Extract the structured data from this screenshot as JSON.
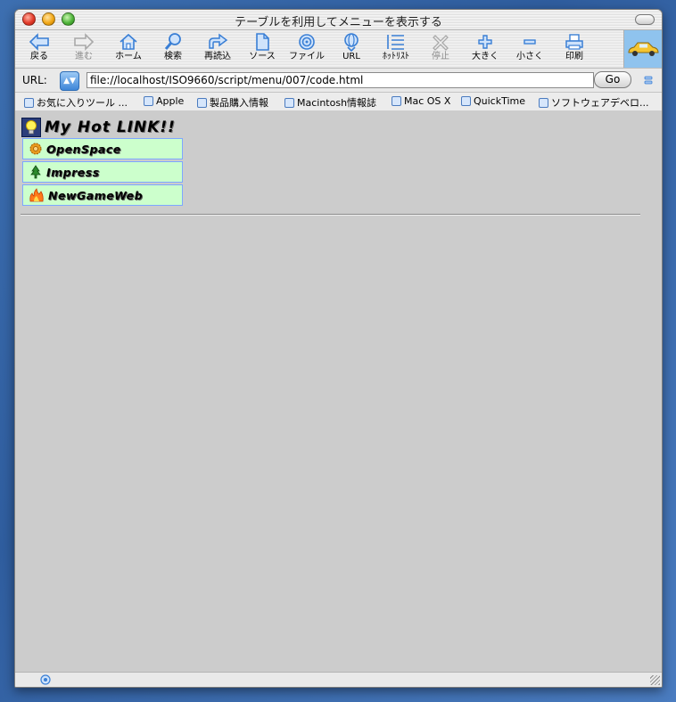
{
  "window": {
    "title": "テーブルを利用してメニューを表示する"
  },
  "toolbar": {
    "buttons": [
      {
        "label": "戻る",
        "icon": "back-arrow-icon",
        "enabled": true
      },
      {
        "label": "進む",
        "icon": "forward-arrow-icon",
        "enabled": false
      },
      {
        "label": "ホーム",
        "icon": "home-icon",
        "enabled": true
      },
      {
        "label": "検索",
        "icon": "search-icon",
        "enabled": true
      },
      {
        "label": "再読込",
        "icon": "reload-icon",
        "enabled": true
      },
      {
        "label": "ソース",
        "icon": "source-document-icon",
        "enabled": true
      },
      {
        "label": "ファイル",
        "icon": "file-target-icon",
        "enabled": true
      },
      {
        "label": "URL",
        "icon": "url-globe-icon",
        "enabled": true
      },
      {
        "label": "ﾎｯﾄﾘｽﾄ",
        "icon": "hotlist-icon",
        "enabled": true
      },
      {
        "label": "停止",
        "icon": "stop-icon",
        "enabled": false
      },
      {
        "label": "大きく",
        "icon": "plus-icon",
        "enabled": true
      },
      {
        "label": "小さく",
        "icon": "minus-icon",
        "enabled": true
      },
      {
        "label": "印刷",
        "icon": "printer-icon",
        "enabled": true
      }
    ]
  },
  "urlbar": {
    "label": "URL:",
    "value": "file://localhost/ISO9660/script/menu/007/code.html",
    "go_label": "Go"
  },
  "favorites": [
    {
      "label": "お気に入りツール ..."
    },
    {
      "label": "Apple"
    },
    {
      "label": "製品購入情報"
    },
    {
      "label": "Macintosh情報誌"
    },
    {
      "label": "Mac OS X"
    },
    {
      "label": "QuickTime"
    },
    {
      "label": "ソフトウェアデベロ..."
    }
  ],
  "page": {
    "heading": "My Hot LINK!!",
    "menu": [
      {
        "label": "OpenSpace",
        "icon": "gear-icon"
      },
      {
        "label": "Impress",
        "icon": "tree-icon"
      },
      {
        "label": "NewGameWeb",
        "icon": "flame-icon"
      }
    ]
  },
  "colors": {
    "menu_bg": "#ccffcc",
    "menu_border": "#7da7ff",
    "content_bg": "#cccccc",
    "icon_blue": "#3a7fd5"
  }
}
